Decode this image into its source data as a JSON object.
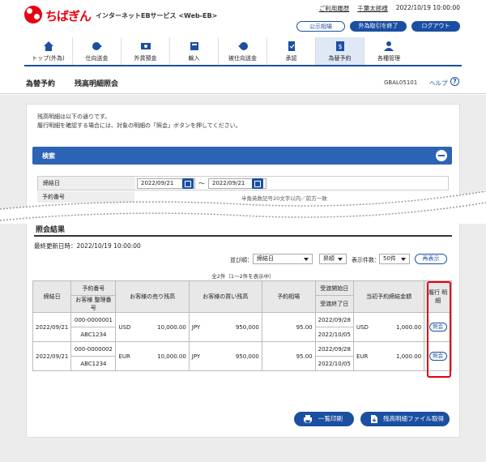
{
  "header": {
    "logo_text": "ちばぎん",
    "service_name": "インターネットEBサービス <Web-EB>",
    "links": [
      "ご利用履歴",
      "千葉太郎様"
    ],
    "datetime": "2022/10/19 10:00:00",
    "buttons": {
      "notice": "公示相場",
      "foreign_end": "外為取引を終了",
      "logout": "ログアウト"
    }
  },
  "nav": {
    "items": [
      "トップ(外為)",
      "仕向送金",
      "外貨預金",
      "輸入",
      "被仕向送金",
      "承認",
      "為替予約",
      "各種管理"
    ],
    "active": "為替予約"
  },
  "page": {
    "breadcrumb_1": "為替予約",
    "title": "残高明細照会",
    "code": "GBAL05101",
    "help": "ヘルプ",
    "help_icon_char": "?"
  },
  "intro": {
    "line1": "残高明細は以下の通りです。",
    "line2": "履行明細を確認する場合には、対象の明細の「照会」ボタンを押してください。"
  },
  "search": {
    "title": "検索",
    "date_label": "締結日",
    "date_from": "2022/09/21",
    "date_sep": "～",
    "date_to": "2022/09/21",
    "yoyaku_label": "予約番号",
    "yoyaku_hint": "半角英数記号20文字以内／前方一致"
  },
  "results": {
    "title": "照会結果",
    "last_update": "最終更新日時：2022/10/19 10:00:00",
    "sort_label": "並び順：",
    "sort_value": "締結日",
    "order_value": "昇順",
    "count_label": "表示件数：",
    "count_value": "50件",
    "redisplay": "再表示",
    "summary": "全2件（1～2件を表示中）",
    "headers": {
      "date": "締結日",
      "yoyaku_no": "予約番号",
      "customer_no": "お客様 整理番号",
      "sell_balance": "お客様の売り残高",
      "buy_balance": "お客様の買い残高",
      "rate": "予約相場",
      "start": "受渡開始日",
      "end": "受渡終了日",
      "contract_amount": "当初予約締結金額",
      "detail": "履行 明細"
    },
    "rows": [
      {
        "date": "2022/09/21",
        "yoyaku_no": "000-0000001",
        "customer_no": "ABC1234",
        "sell_ccy": "USD",
        "sell_amt": "10,000.00",
        "buy_ccy": "JPY",
        "buy_amt": "950,000",
        "rate": "95.00",
        "start": "2022/09/28",
        "end": "2022/10/05",
        "contract_ccy": "USD",
        "contract_amt": "1,000.00",
        "inquire": "照会"
      },
      {
        "date": "2022/09/21",
        "yoyaku_no": "000-0000002",
        "customer_no": "ABC1234",
        "sell_ccy": "EUR",
        "sell_amt": "10,000.00",
        "buy_ccy": "JPY",
        "buy_amt": "950,000",
        "rate": "95.00",
        "start": "2022/09/28",
        "end": "2022/10/05",
        "contract_ccy": "EUR",
        "contract_amt": "1,000.00",
        "inquire": "照会"
      }
    ]
  },
  "footer": {
    "print": "一覧印刷",
    "download": "残高明細ファイル取得"
  },
  "colors": {
    "brand_red": "#e60012",
    "primary_blue": "#1b4fa1",
    "search_blue": "#2d63b5"
  }
}
